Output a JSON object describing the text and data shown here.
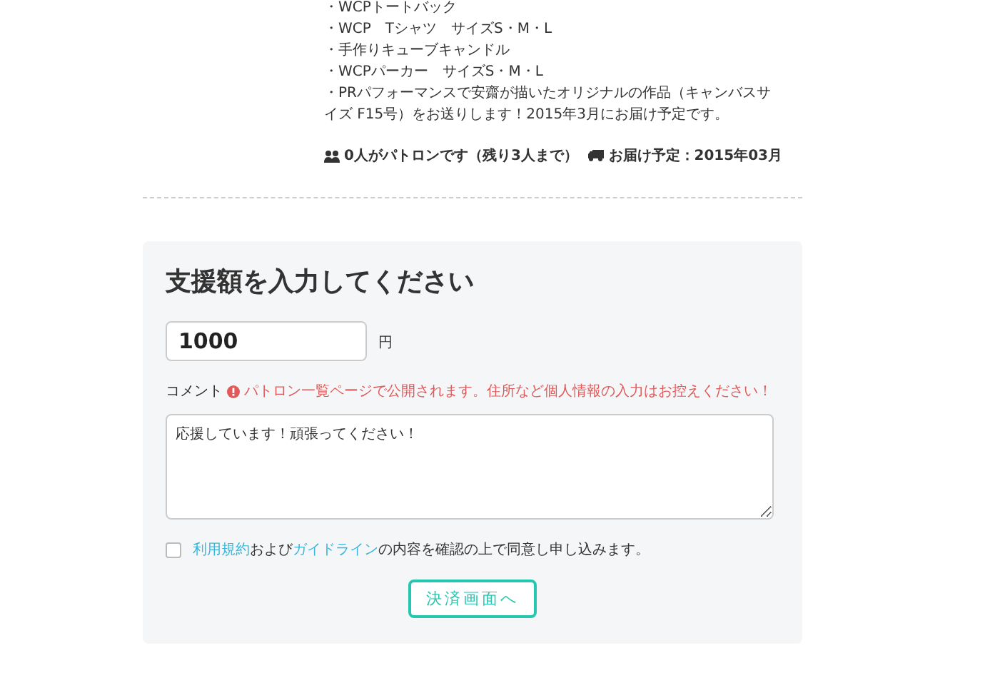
{
  "reward": {
    "lines": [
      "・WCPトートバック",
      "・WCP　Tシャツ　サイズS・M・L",
      "・手作りキューブキャンドル",
      "・WCPパーカー　サイズS・M・L",
      "・PRパフォーマンスで安齋が描いたオリジナルの作品（キャンバスサイズ F15号）をお送りします！2015年3月にお届け予定です。"
    ],
    "patrons": "0人がパトロンです（残り3人まで）",
    "delivery": "お届け予定：2015年03月"
  },
  "form": {
    "title": "支援額を入力してください",
    "amount": {
      "value": "1000",
      "unit": "円"
    },
    "comment": {
      "label": "コメント",
      "warning": "パトロン一覧ページで公開されます。住所など個人情報の入力はお控えください！",
      "value": "応援しています！頑張ってください！"
    },
    "agreement": {
      "checked": false,
      "parts": [
        {
          "kind": "link",
          "text": "利用規約"
        },
        {
          "kind": "text",
          "text": "および"
        },
        {
          "kind": "link",
          "text": "ガイドライン"
        },
        {
          "kind": "text",
          "text": "の内容を確認の上で同意し申し込みます。"
        }
      ]
    },
    "submit": "決済画面へ"
  }
}
